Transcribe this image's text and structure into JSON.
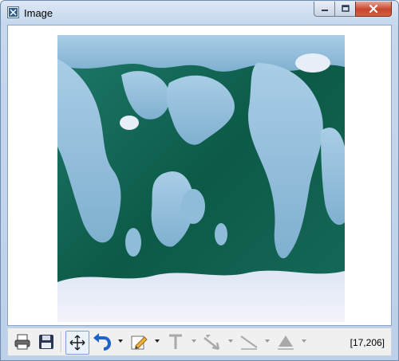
{
  "window": {
    "title": "Image",
    "minimize_icon": "minimize-icon",
    "maximize_icon": "maximize-icon",
    "close_icon": "close-icon"
  },
  "image": {
    "icon": "world-map-image"
  },
  "toolbar": {
    "items": [
      {
        "name": "print",
        "icon": "printer-icon"
      },
      {
        "name": "save",
        "icon": "floppy-disk-icon"
      },
      {
        "name": "fit",
        "icon": "move-arrows-icon"
      },
      {
        "name": "undo",
        "icon": "undo-arrow-icon",
        "has_dropdown": true
      },
      {
        "name": "pencil",
        "icon": "pencil-icon",
        "has_dropdown": true
      },
      {
        "name": "text",
        "icon": "text-tool-icon",
        "has_dropdown": true,
        "enabled": false
      },
      {
        "name": "arrow",
        "icon": "arrow-tool-icon",
        "has_dropdown": true,
        "enabled": false
      },
      {
        "name": "line",
        "icon": "line-tool-icon",
        "has_dropdown": true,
        "enabled": false
      },
      {
        "name": "shape",
        "icon": "triangle-shape-icon",
        "has_dropdown": true,
        "enabled": false
      }
    ],
    "coordinates": "[17,206]"
  },
  "colors": {
    "ocean": "#0d5a48",
    "land": "#8fbcd8",
    "ice": "#e8eef8",
    "accent_undo": "#1f63c7"
  }
}
